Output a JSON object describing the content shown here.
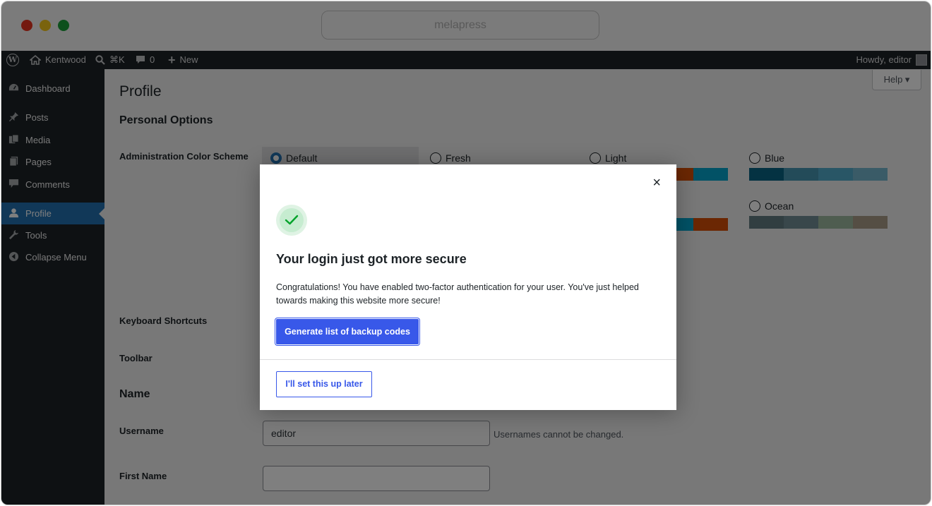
{
  "browser": {
    "url": "melapress"
  },
  "admin_bar": {
    "site_name": "Kentwood",
    "search_shortcut": "⌘K",
    "comments_count": "0",
    "new_label": "New",
    "greeting": "Howdy, editor"
  },
  "sidebar": {
    "items": [
      {
        "label": "Dashboard",
        "icon": "dashboard-icon"
      },
      {
        "label": "Posts",
        "icon": "pushpin-icon"
      },
      {
        "label": "Media",
        "icon": "media-icon"
      },
      {
        "label": "Pages",
        "icon": "pages-icon"
      },
      {
        "label": "Comments",
        "icon": "comment-icon"
      },
      {
        "label": "Profile",
        "icon": "user-icon"
      },
      {
        "label": "Tools",
        "icon": "wrench-icon"
      },
      {
        "label": "Collapse Menu",
        "icon": "collapse-icon"
      }
    ],
    "active": "Profile"
  },
  "main": {
    "help_label": "Help ▾",
    "page_title": "Profile",
    "personal_options": "Personal Options",
    "color_scheme_label": "Administration Color Scheme",
    "schemes": [
      {
        "name": "Default",
        "selected": true,
        "colors": [
          "#1d2327",
          "#2c3338",
          "#2271b1",
          "#72aee6"
        ]
      },
      {
        "name": "Fresh",
        "selected": false,
        "colors": [
          "#2c3338",
          "#3c434a",
          "#e26f56",
          "#d63638"
        ]
      },
      {
        "name": "Light",
        "selected": false,
        "colors": [
          "#e5e5e5",
          "#999999",
          "#d64e07",
          "#04a4cc"
        ]
      },
      {
        "name": "Blue",
        "selected": false,
        "colors": [
          "#096484",
          "#4796b3",
          "#52accc",
          "#74b6ce"
        ]
      },
      {
        "name": "Ocean",
        "selected": false,
        "colors": [
          "#627c83",
          "#738e96",
          "#9ebaa0",
          "#aa9d88"
        ]
      }
    ],
    "keyboard_shortcuts_label": "Keyboard Shortcuts",
    "toolbar_label": "Toolbar",
    "name_section": "Name",
    "username_label": "Username",
    "username_value": "editor",
    "username_hint": "Usernames cannot be changed.",
    "first_name_label": "First Name",
    "first_name_value": ""
  },
  "modal": {
    "close_symbol": "×",
    "title": "Your login just got more secure",
    "message": "Congratulations! You have enabled two-factor authentication for your user. You've just helped towards making this website more secure!",
    "primary_button": "Generate list of backup codes",
    "secondary_button": "I'll set this up later"
  },
  "colors": {
    "accent": "#3858e9",
    "admin_bar": "#1d2327",
    "active_menu": "#2271b1",
    "success": "#00a32a"
  }
}
